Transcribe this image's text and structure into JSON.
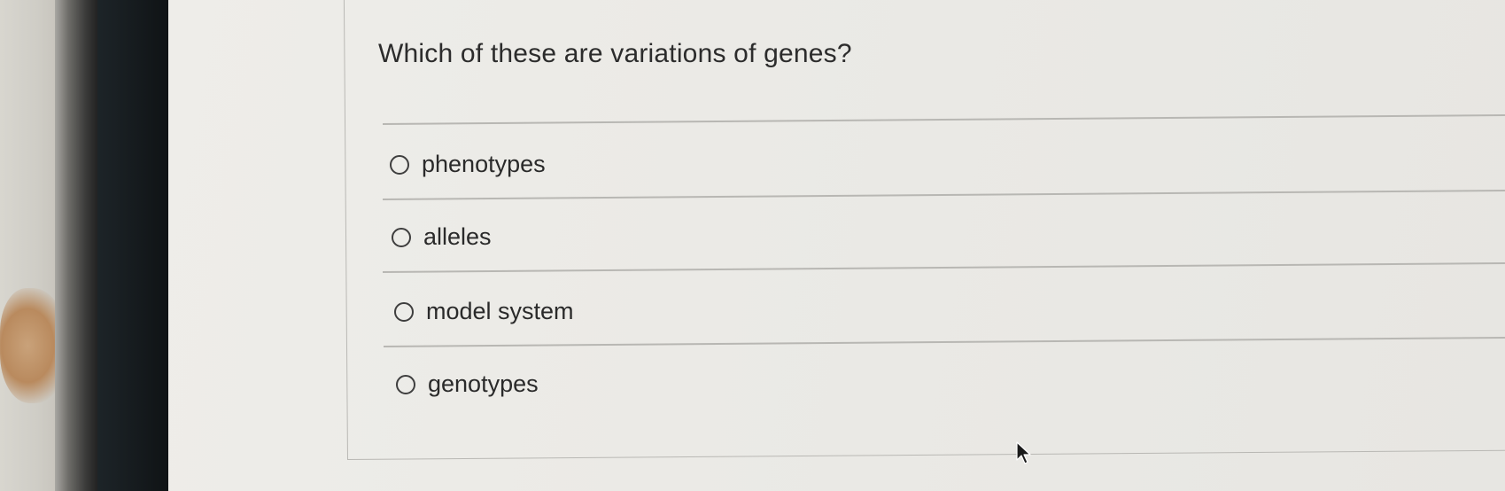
{
  "question": {
    "text": "Which of these are variations of genes?"
  },
  "options": [
    {
      "label": "phenotypes",
      "selected": false
    },
    {
      "label": "alleles",
      "selected": false
    },
    {
      "label": "model system",
      "selected": false
    },
    {
      "label": "genotypes",
      "selected": false
    }
  ]
}
